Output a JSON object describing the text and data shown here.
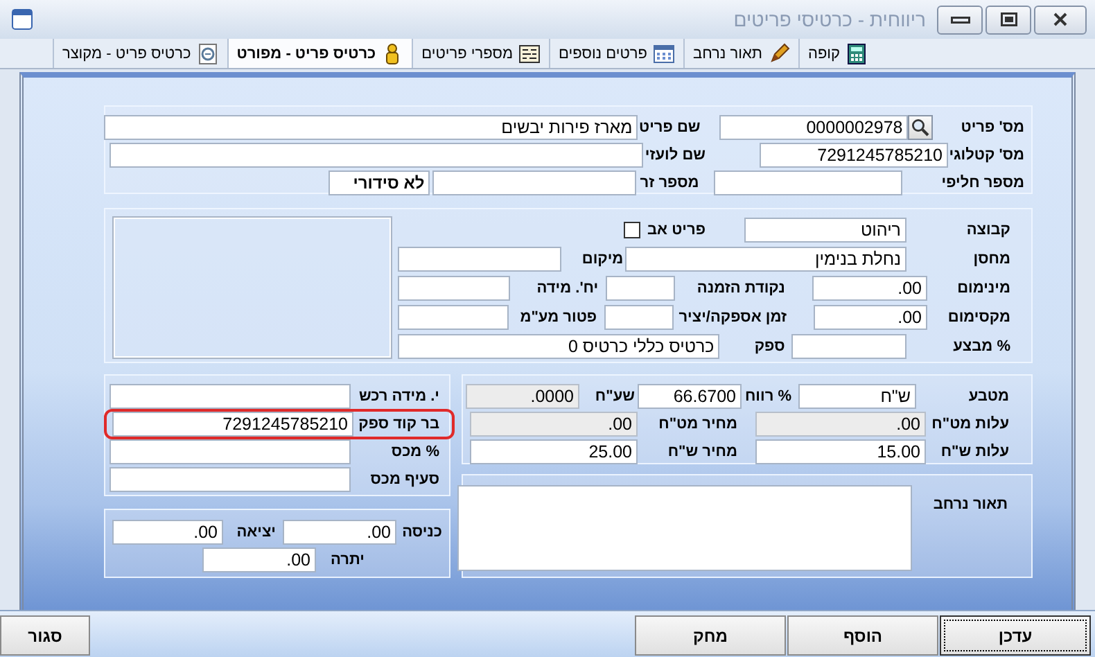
{
  "window": {
    "title": "ריווחית - כרטיסי פריטים"
  },
  "tabs": [
    {
      "label": "קופה",
      "selected": false
    },
    {
      "label": "תאור נרחב",
      "selected": false
    },
    {
      "label": "פרטים נוספים",
      "selected": false
    },
    {
      "label": "מספרי פריטים",
      "selected": false
    },
    {
      "label": "כרטיס פריט - מפורט",
      "selected": true
    },
    {
      "label": "כרטיס פריט - מקוצר",
      "selected": false
    }
  ],
  "panels": [
    {
      "lines": [
        {
          "items": [
            {
              "kind": "label",
              "text": "מס' פריט"
            },
            {
              "kind": "lookup"
            },
            {
              "kind": "field",
              "value": "0000002978"
            },
            {
              "kind": "label",
              "text": "שם פריט"
            },
            {
              "kind": "field",
              "value": "מארז פירות יבשים"
            }
          ]
        },
        {
          "items": [
            {
              "kind": "label",
              "text": "מס' קטלוגי"
            },
            {
              "kind": "field",
              "value": "7291245785210"
            },
            {
              "kind": "label",
              "text": "שם לועזי"
            },
            {
              "kind": "field"
            }
          ]
        },
        {
          "items": [
            {
              "kind": "label",
              "text": "מספר חליפי"
            },
            {
              "kind": "field"
            },
            {
              "kind": "label",
              "text": "מספר זר"
            },
            {
              "kind": "field"
            },
            {
              "kind": "tag",
              "text": "לא סידורי"
            }
          ]
        }
      ]
    },
    {
      "image_slot": true,
      "lines": [
        {
          "items": [
            {
              "kind": "label",
              "text": "קבוצה"
            },
            {
              "kind": "field",
              "value": "ריהוט"
            },
            {
              "kind": "label",
              "text": "פריט אב"
            },
            {
              "kind": "checkbox",
              "checked": false
            }
          ]
        },
        {
          "items": [
            {
              "kind": "label",
              "text": "מחסן"
            },
            {
              "kind": "field",
              "value": "נחלת בנימין"
            },
            {
              "kind": "label",
              "text": "מיקום"
            },
            {
              "kind": "field"
            }
          ]
        },
        {
          "items": [
            {
              "kind": "label",
              "text": "מינימום"
            },
            {
              "kind": "field",
              "value": ".00"
            },
            {
              "kind": "label",
              "text": "נקודת הזמנה"
            },
            {
              "kind": "field"
            },
            {
              "kind": "label",
              "text": "יח'. מידה"
            },
            {
              "kind": "field"
            }
          ]
        },
        {
          "items": [
            {
              "kind": "label",
              "text": "מקסימום"
            },
            {
              "kind": "field",
              "value": ".00"
            },
            {
              "kind": "label",
              "text": "זמן אספקה/יציר"
            },
            {
              "kind": "field"
            },
            {
              "kind": "label",
              "text": "פטור מע\"מ"
            },
            {
              "kind": "field"
            }
          ]
        },
        {
          "items": [
            {
              "kind": "label",
              "text": "% מבצע"
            },
            {
              "kind": "field"
            },
            {
              "kind": "label",
              "text": "ספק"
            },
            {
              "kind": "field",
              "value": "כרטיס כללי כרטיס 0"
            }
          ]
        }
      ]
    },
    {
      "lines": [
        {
          "items": [
            {
              "kind": "label",
              "text": "מטבע"
            },
            {
              "kind": "field",
              "value": "ש\"ח",
              "readonly": false
            },
            {
              "kind": "label",
              "text": "% רווח"
            },
            {
              "kind": "field",
              "value": "66.6700",
              "readonly": false
            },
            {
              "kind": "label",
              "text": "שע\"ח"
            },
            {
              "kind": "field",
              "value": ".0000",
              "readonly": true
            }
          ]
        },
        {
          "items": [
            {
              "kind": "label",
              "text": "עלות מט\"ח"
            },
            {
              "kind": "field",
              "value": ".00",
              "readonly": true
            },
            {
              "kind": "label",
              "text": "מחיר מט\"ח"
            },
            {
              "kind": "field",
              "value": ".00",
              "readonly": true
            }
          ]
        },
        {
          "items": [
            {
              "kind": "label",
              "text": "עלות ש\"ח"
            },
            {
              "kind": "field",
              "value": "15.00",
              "readonly": false
            },
            {
              "kind": "label",
              "text": "מחיר ש\"ח"
            },
            {
              "kind": "field",
              "value": "25.00",
              "readonly": false
            }
          ]
        }
      ]
    },
    {
      "lines": [
        {
          "highlighted": false,
          "items": [
            {
              "kind": "label",
              "text": "י. מידה רכש"
            },
            {
              "kind": "field"
            }
          ]
        },
        {
          "highlighted": true,
          "items": [
            {
              "kind": "label",
              "text": "בר קוד ספק"
            },
            {
              "kind": "field",
              "value": "7291245785210"
            }
          ]
        },
        {
          "highlighted": false,
          "items": [
            {
              "kind": "label",
              "text": "% מכס"
            },
            {
              "kind": "field"
            }
          ]
        },
        {
          "highlighted": false,
          "items": [
            {
              "kind": "label",
              "text": "סעיף מכס"
            },
            {
              "kind": "field"
            }
          ]
        }
      ]
    },
    {
      "lines": [
        {
          "items": [
            {
              "kind": "label",
              "text": "כניסה"
            },
            {
              "kind": "field",
              "value": ".00"
            },
            {
              "kind": "label",
              "text": "יציאה"
            },
            {
              "kind": "field",
              "value": ".00"
            }
          ]
        },
        {
          "items": [
            {
              "kind": "label",
              "text": "יתרה"
            },
            {
              "kind": "field",
              "value": ".00"
            }
          ]
        }
      ]
    },
    {
      "lines": [
        {
          "items": [
            {
              "kind": "label",
              "text": "תאור נרחב"
            },
            {
              "kind": "textarea"
            }
          ]
        }
      ]
    }
  ],
  "buttons": [
    {
      "label": "עדכן",
      "focused": true
    },
    {
      "label": "הוסף",
      "focused": false
    },
    {
      "label": "מחק",
      "focused": false
    },
    {
      "label": "סגור",
      "focused": false
    }
  ]
}
